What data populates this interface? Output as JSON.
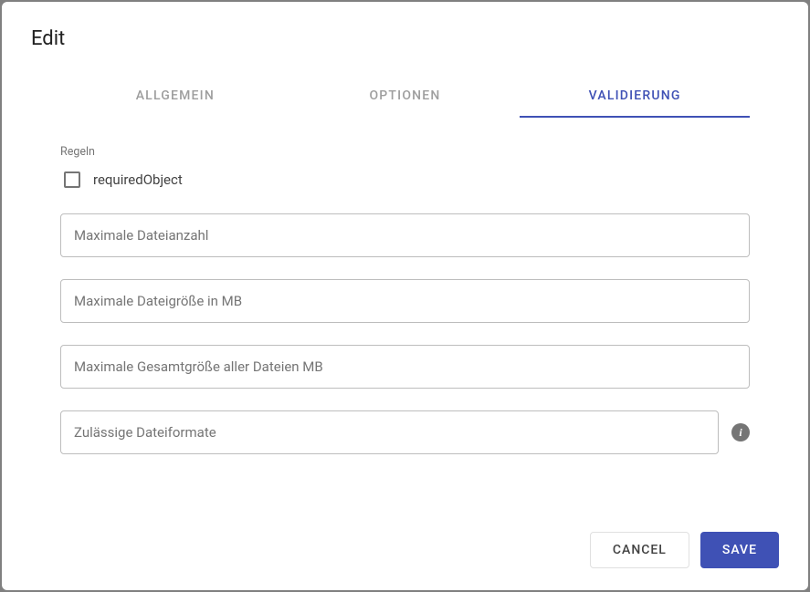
{
  "dialog": {
    "title": "Edit"
  },
  "tabs": {
    "general": "Allgemein",
    "options": "Optionen",
    "validation": "Validierung"
  },
  "rules": {
    "label": "Regeln",
    "required_object_label": "requiredObject"
  },
  "fields": {
    "max_file_count_placeholder": "Maximale Dateianzahl",
    "max_file_size_mb_placeholder": "Maximale Dateigröße in MB",
    "max_total_size_mb_placeholder": "Maximale Gesamtgröße aller Dateien MB",
    "allowed_formats_placeholder": "Zulässige Dateiformate"
  },
  "actions": {
    "cancel_label": "Cancel",
    "save_label": "Save"
  }
}
